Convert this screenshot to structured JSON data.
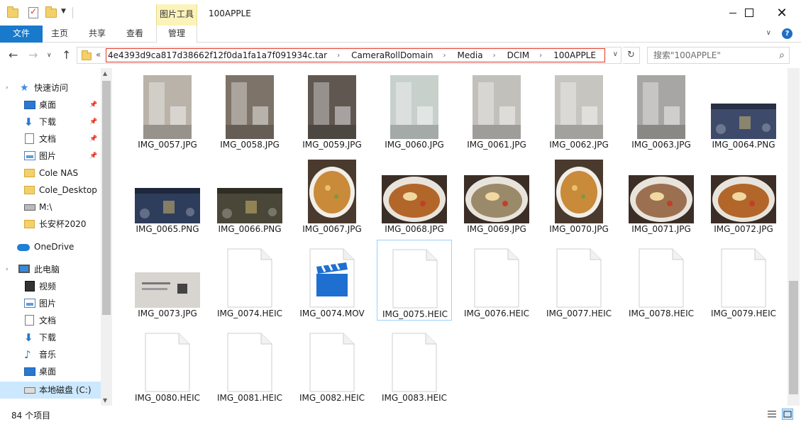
{
  "titlebar": {
    "title": "100APPLE",
    "contextual_tab": "图片工具"
  },
  "ribbon": {
    "tabs": [
      "文件",
      "主页",
      "共享",
      "查看",
      "管理"
    ]
  },
  "address": {
    "crumbs": [
      "4e4393d9ca817d38662f12f0da1fa1a7f091934c.tar",
      "CameraRollDomain",
      "Media",
      "DCIM",
      "100APPLE"
    ],
    "overflow": "«",
    "search_placeholder": "搜索\"100APPLE\""
  },
  "sidebar": {
    "items": [
      {
        "label": "快速访问",
        "icon": "star-icon",
        "pinned": false
      },
      {
        "label": "桌面",
        "icon": "desktop-icon",
        "pinned": true
      },
      {
        "label": "下载",
        "icon": "download-icon",
        "pinned": true
      },
      {
        "label": "文档",
        "icon": "document-icon",
        "pinned": true
      },
      {
        "label": "图片",
        "icon": "picture-icon",
        "pinned": true
      },
      {
        "label": "Cole NAS",
        "icon": "folder-icon",
        "pinned": false
      },
      {
        "label": "Cole_Desktop",
        "icon": "folder-icon",
        "pinned": false
      },
      {
        "label": "M:\\",
        "icon": "network-drive-icon",
        "pinned": false
      },
      {
        "label": "长安杯2020",
        "icon": "folder-icon",
        "pinned": false
      },
      {
        "label": "OneDrive",
        "icon": "onedrive-icon",
        "pinned": false
      },
      {
        "label": "此电脑",
        "icon": "this-pc-icon",
        "pinned": false
      },
      {
        "label": "视频",
        "icon": "video-icon",
        "pinned": false
      },
      {
        "label": "图片",
        "icon": "picture-icon",
        "pinned": false
      },
      {
        "label": "文档",
        "icon": "document-icon",
        "pinned": false
      },
      {
        "label": "下载",
        "icon": "download-icon",
        "pinned": false
      },
      {
        "label": "音乐",
        "icon": "music-icon",
        "pinned": false
      },
      {
        "label": "桌面",
        "icon": "desktop-icon",
        "pinned": false
      },
      {
        "label": "本地磁盘 (C:)",
        "icon": "local-disk-icon",
        "pinned": false
      }
    ]
  },
  "files": [
    {
      "name": "IMG_0057.JPG",
      "kind": "photo-portrait",
      "color": "#b9b3aa"
    },
    {
      "name": "IMG_0058.JPG",
      "kind": "photo-portrait",
      "color": "#7d7368"
    },
    {
      "name": "IMG_0059.JPG",
      "kind": "photo-portrait",
      "color": "#5f5750"
    },
    {
      "name": "IMG_0060.JPG",
      "kind": "photo-portrait",
      "color": "#c8d0cc"
    },
    {
      "name": "IMG_0061.JPG",
      "kind": "photo-portrait",
      "color": "#c2c0bb"
    },
    {
      "name": "IMG_0062.JPG",
      "kind": "photo-portrait",
      "color": "#c7c5c0"
    },
    {
      "name": "IMG_0063.JPG",
      "kind": "photo-portrait",
      "color": "#a8a6a3"
    },
    {
      "name": "IMG_0064.PNG",
      "kind": "screenshot-landscape",
      "color": "#3d4a6a"
    },
    {
      "name": "IMG_0065.PNG",
      "kind": "screenshot-landscape",
      "color": "#2f3d5c"
    },
    {
      "name": "IMG_0066.PNG",
      "kind": "screenshot-landscape",
      "color": "#4a4638"
    },
    {
      "name": "IMG_0067.JPG",
      "kind": "food-portrait",
      "color": "#c98a3a"
    },
    {
      "name": "IMG_0068.JPG",
      "kind": "food-landscape",
      "color": "#b3662a"
    },
    {
      "name": "IMG_0069.JPG",
      "kind": "food-landscape",
      "color": "#9b8a6a"
    },
    {
      "name": "IMG_0070.JPG",
      "kind": "food-portrait",
      "color": "#c98a3a"
    },
    {
      "name": "IMG_0071.JPG",
      "kind": "food-landscape",
      "color": "#9b7050"
    },
    {
      "name": "IMG_0072.JPG",
      "kind": "food-landscape",
      "color": "#b3662a"
    },
    {
      "name": "IMG_0073.JPG",
      "kind": "doc-landscape",
      "color": "#d8d4d0"
    },
    {
      "name": "IMG_0074.HEIC",
      "kind": "generic"
    },
    {
      "name": "IMG_0074.MOV",
      "kind": "movie"
    },
    {
      "name": "IMG_0075.HEIC",
      "kind": "generic",
      "selected": true
    },
    {
      "name": "IMG_0076.HEIC",
      "kind": "generic"
    },
    {
      "name": "IMG_0077.HEIC",
      "kind": "generic"
    },
    {
      "name": "IMG_0078.HEIC",
      "kind": "generic"
    },
    {
      "name": "IMG_0079.HEIC",
      "kind": "generic"
    },
    {
      "name": "IMG_0080.HEIC",
      "kind": "generic"
    },
    {
      "name": "IMG_0081.HEIC",
      "kind": "generic"
    },
    {
      "name": "IMG_0082.HEIC",
      "kind": "generic"
    },
    {
      "name": "IMG_0083.HEIC",
      "kind": "generic"
    }
  ],
  "status": {
    "count": "84 个项目"
  },
  "colors": {
    "accent": "#1979ca",
    "selection": "#cce8ff",
    "picture_tools": "#fbf3b9",
    "highlight_border": "#e0392a"
  }
}
